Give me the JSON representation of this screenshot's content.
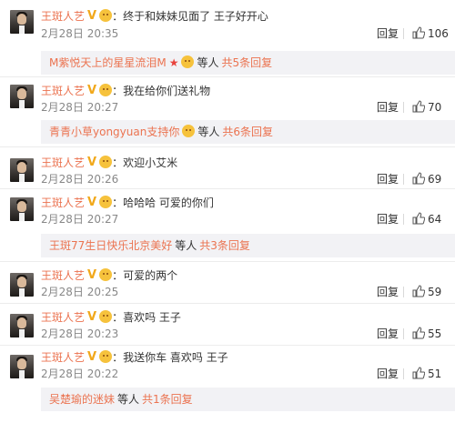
{
  "comments": [
    {
      "user": "王斑人艺",
      "text": "终于和妹妹见面了 王子好开心",
      "time": "2月28日 20:35",
      "reply": "回复",
      "likes": "106"
    },
    {
      "user": "王斑人艺",
      "text": "我在给你们送礼物",
      "time": "2月28日 20:27",
      "reply": "回复",
      "likes": "70"
    },
    {
      "user": "王斑人艺",
      "text": "欢迎小艾米",
      "time": "2月28日 20:26",
      "reply": "回复",
      "likes": "69"
    },
    {
      "user": "王斑人艺",
      "text": "哈哈哈 可爱的你们",
      "time": "2月28日 20:27",
      "reply": "回复",
      "likes": "64"
    },
    {
      "user": "王斑人艺",
      "text": "可爱的两个",
      "time": "2月28日 20:25",
      "reply": "回复",
      "likes": "59"
    },
    {
      "user": "王斑人艺",
      "text": "喜欢吗 王子",
      "time": "2月28日 20:23",
      "reply": "回复",
      "likes": "55"
    },
    {
      "user": "王斑人艺",
      "text": "我送你车 喜欢吗 王子",
      "time": "2月28日 20:22",
      "reply": "回复",
      "likes": "51"
    }
  ],
  "subreplies": [
    {
      "who": "M紫悦天上的星星流泪M",
      "star": "★",
      "etc": "等人",
      "count": "共5条回复"
    },
    {
      "who": "青青小草yongyuan支持你",
      "etc": "等人",
      "count": "共6条回复"
    },
    {
      "who": "王斑77生日快乐北京美好",
      "etc": "等人",
      "count": "共3条回复"
    },
    {
      "who": "吴楚瑜的迷妹",
      "etc": "等人",
      "count": "共1条回复"
    }
  ],
  "colon": "：",
  "verified_badge": "V",
  "icons": {
    "avatar": "avatar",
    "vip": "verified-v-icon",
    "emoji": "crown-emoji-icon",
    "like": "thumbs-up-icon"
  },
  "colors": {
    "username": "#eb7350",
    "sub_bg": "#f2f2f5",
    "badge": "#f1a81b"
  }
}
